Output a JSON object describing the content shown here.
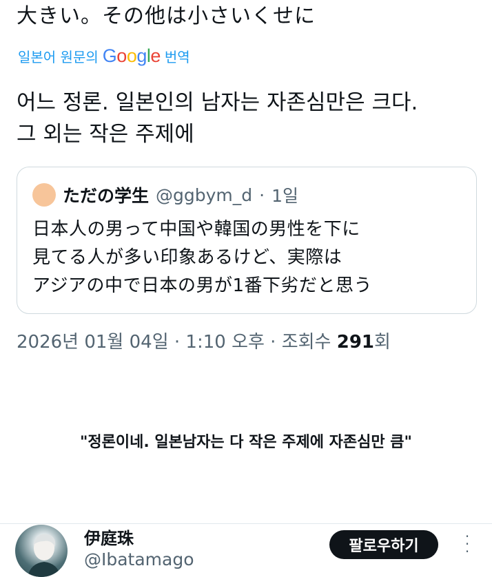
{
  "post": {
    "original_text": "大きい。その他は小さいくせに",
    "translate_prefix": "일본어 원문의",
    "translate_brand": [
      "G",
      "o",
      "o",
      "g",
      "l",
      "e"
    ],
    "translate_suffix": "번역",
    "translated_line1": "어느 정론. 일본인의 남자는 자존심만은 크다.",
    "translated_line2": "그 외는 작은 주제에"
  },
  "quote": {
    "name": "ただの学生",
    "handle": "@ggbym_d",
    "separator": "·",
    "age": "1일",
    "line1": "日本人の男って中国や韓国の男性を下に",
    "line2": "見てる人が多い印象あるけど、実際は",
    "line3": "アジアの中で日本の男が1番下劣だと思う"
  },
  "timestamp": {
    "date_time": "2026년 01월 04일 · 1:10 오후 · 조회수",
    "views": "291",
    "views_suffix": "회"
  },
  "caption": "\"정론이네. 일본남자는 다 작은 주제에 자존심만 큼\"",
  "profile": {
    "name": "伊庭珠",
    "handle": "@Ibatamago",
    "follow_label": "팔로우하기",
    "more_icon": "vertical-ellipsis"
  },
  "colors": {
    "link_blue": "#1d9bf0",
    "secondary_text": "#536471",
    "follow_bg": "#0f1419"
  }
}
